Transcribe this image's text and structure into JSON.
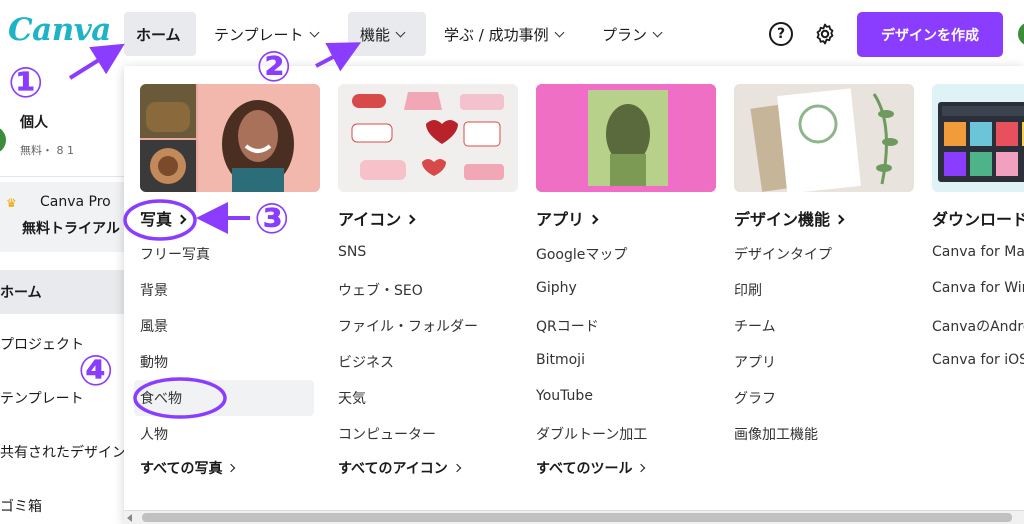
{
  "header": {
    "logo_text": "Canva",
    "nav": {
      "home": "ホーム",
      "templates": "テンプレート",
      "features": "機能",
      "learn": "学ぶ / 成功事例",
      "plans": "プラン"
    },
    "help_glyph": "?",
    "create_button": "デザインを作成"
  },
  "sidebar": {
    "account_name": "個人",
    "account_meta": "無料・ 8 1",
    "pro_title": "Canva Pro",
    "pro_subtitle": "無料トライアル",
    "home": "ホーム",
    "links": [
      "プロジェクト",
      "テンプレート",
      "共有されたデザイン",
      "ゴミ箱"
    ]
  },
  "dropdown": {
    "columns": [
      {
        "heading": "写真",
        "items": [
          "フリー写真",
          "背景",
          "風景",
          "動物",
          "食べ物",
          "人物"
        ],
        "all_link": "すべての写真"
      },
      {
        "heading": "アイコン",
        "items": [
          "SNS",
          "ウェブ・SEO",
          "ファイル・フォルダー",
          "ビジネス",
          "天気",
          "コンピューター"
        ],
        "all_link": "すべてのアイコン"
      },
      {
        "heading": "アプリ",
        "items": [
          "Googleマップ",
          "Giphy",
          "QRコード",
          "Bitmoji",
          "YouTube",
          "ダブルトーン加工"
        ],
        "all_link": "すべてのツール"
      },
      {
        "heading": "デザイン機能",
        "items": [
          "デザインタイプ",
          "印刷",
          "チーム",
          "アプリ",
          "グラフ",
          "画像加工機能"
        ]
      },
      {
        "heading": "ダウンロード",
        "items": [
          "Canva for Mac",
          "Canva for Windows",
          "CanvaのAndroid",
          "Canva for iOS"
        ]
      }
    ],
    "sticker_texts": [
      "I ♥ YOU",
      "HONEY",
      "MY LOVE",
      "FAVORITE",
      "BE MY VALENTINE?",
      "KISS ME",
      "Forever"
    ]
  },
  "annotations": {
    "step1": "①",
    "step2": "②",
    "step3": "③",
    "step4": "④"
  },
  "colors": {
    "brand_purple": "#8b3dff",
    "logo_teal": "#1fb3c8",
    "annotation_purple": "#8b3dff"
  }
}
